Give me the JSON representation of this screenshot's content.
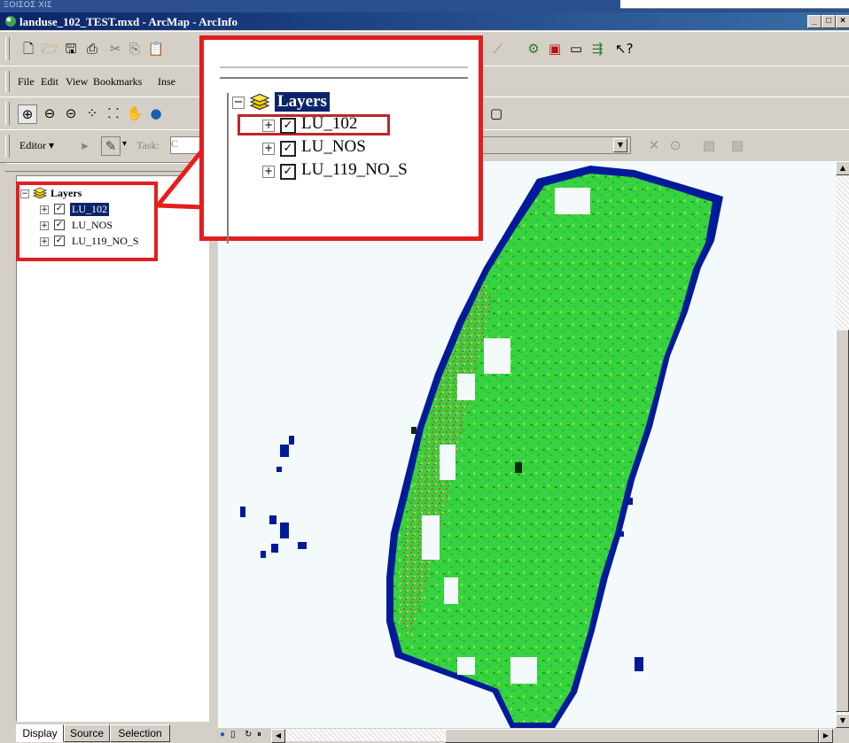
{
  "top_strip": {
    "text": "ΞΟΙΣΟΣ ΧΙΣ"
  },
  "window": {
    "title": "landuse_102_TEST.mxd - ArcMap - ArcInfo",
    "minimize": "_",
    "maximize": "□",
    "close": "×"
  },
  "menu": {
    "items": [
      {
        "label": "File",
        "accel": "F"
      },
      {
        "label": "Edit",
        "accel": "E"
      },
      {
        "label": "View",
        "accel": "V"
      },
      {
        "label": "Bookmarks",
        "accel": "B"
      },
      {
        "label": "Inse",
        "accel": "I"
      }
    ]
  },
  "editor": {
    "label": "Editor",
    "task_label": "Task:",
    "task_value": "C"
  },
  "toc": {
    "root_label": "Layers",
    "layers": [
      {
        "name": "LU_102",
        "selected": true,
        "checked": true
      },
      {
        "name": "LU_NOS",
        "selected": false,
        "checked": true
      },
      {
        "name": "LU_119_NO_S",
        "selected": false,
        "checked": true
      }
    ]
  },
  "callout": {
    "root_label": "Layers",
    "layers": [
      "LU_102",
      "LU_NOS",
      "LU_119_NO_S"
    ],
    "highlighted": "LU_102"
  },
  "tabs": [
    "Display",
    "Source",
    "Selection"
  ],
  "colors": {
    "accent": "#e31e1e",
    "selection": "#0a246a",
    "titlebar": "#0a246a",
    "map_green": "#33cc33",
    "map_blue": "#001a99"
  },
  "icons": {
    "new": "new-document-icon",
    "open": "open-folder-icon",
    "save": "save-icon",
    "print": "print-icon",
    "zoom_in": "zoom-in-icon",
    "pan": "pan-hand-icon",
    "globe": "full-extent-icon",
    "help": "whats-this-icon"
  }
}
